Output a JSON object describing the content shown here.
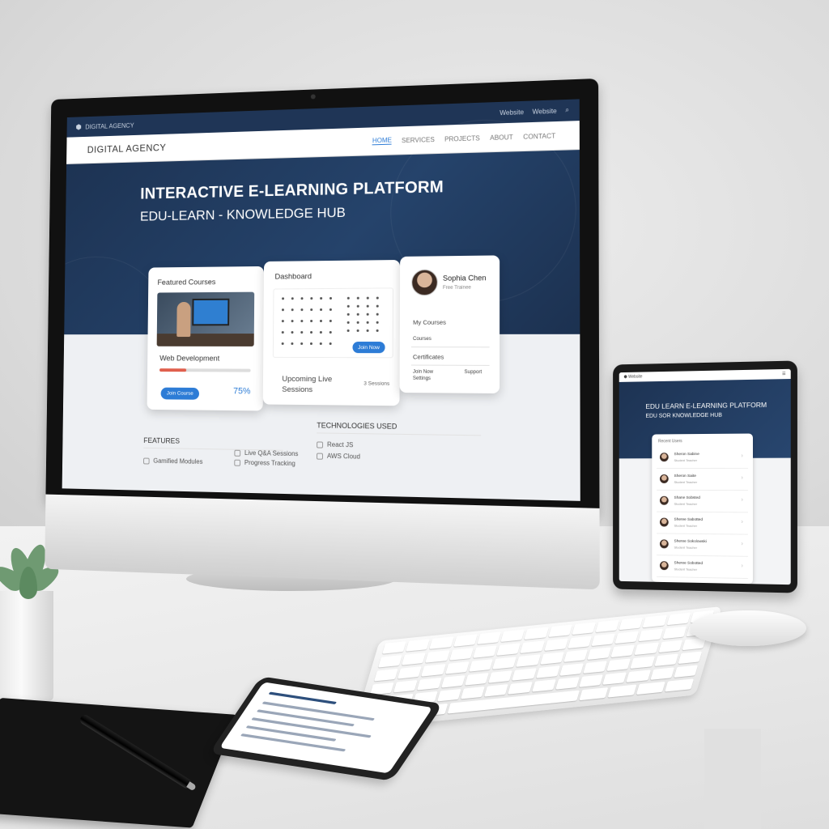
{
  "monitor": {
    "topbar": {
      "brand": "DIGITAL AGENCY",
      "item1": "Website",
      "item2": "Website"
    },
    "navbar": {
      "brand": "DIGITAL AGENCY",
      "links": [
        "HOME",
        "SERVICES",
        "PROJECTS",
        "ABOUT",
        "CONTACT"
      ],
      "active": "HOME"
    },
    "hero": {
      "title": "INTERACTIVE E-LEARNING PLATFORM",
      "subtitle": "EDU-LEARN - KNOWLEDGE HUB"
    },
    "featured_card": {
      "heading": "Featured Courses",
      "course": "Web Development",
      "progress_percent": 0.3,
      "button": "Join Course",
      "percent_label": "75%"
    },
    "dashboard_card": {
      "heading": "Dashboard",
      "button": "Join Now",
      "sessions_label": "Upcoming Live Sessions",
      "sessions_count": "3 Sessions"
    },
    "profile_card": {
      "name": "Sophia Chen",
      "role": "Free Trainee",
      "menu": [
        "My Courses",
        "Courses",
        "Certificates",
        "Join Now",
        "Settings",
        "Support"
      ]
    },
    "features": {
      "heading": "FEATURES",
      "items": [
        "Gamified Modules",
        "Live Q&A Sessions",
        "Progress Tracking"
      ]
    },
    "technologies": {
      "heading": "TECHNOLOGIES USED",
      "items": [
        "React JS",
        "AWS Cloud"
      ]
    }
  },
  "tablet": {
    "top_label": "Website",
    "title": "EDU LEARN E-LEARNING PLATFORM",
    "subtitle": "EDU SOR KNOWLEDGE HUB",
    "panel_heading": "Recent Users",
    "rows": [
      {
        "name": "Sheron Sabine",
        "role": "Student Teacher"
      },
      {
        "name": "Sheron Saite",
        "role": "Student Teacher"
      },
      {
        "name": "Shane Sobsted",
        "role": "Student Teacher"
      },
      {
        "name": "Sheree Sabotted",
        "role": "Student Teacher"
      },
      {
        "name": "Sheree Sokolowski",
        "role": "Student Teacher"
      },
      {
        "name": "Sheree Sobotted",
        "role": "Student Teacher"
      }
    ]
  },
  "colors": {
    "navy": "#1f3556",
    "accent": "#2d7cd6",
    "progress": "#e0604e"
  }
}
